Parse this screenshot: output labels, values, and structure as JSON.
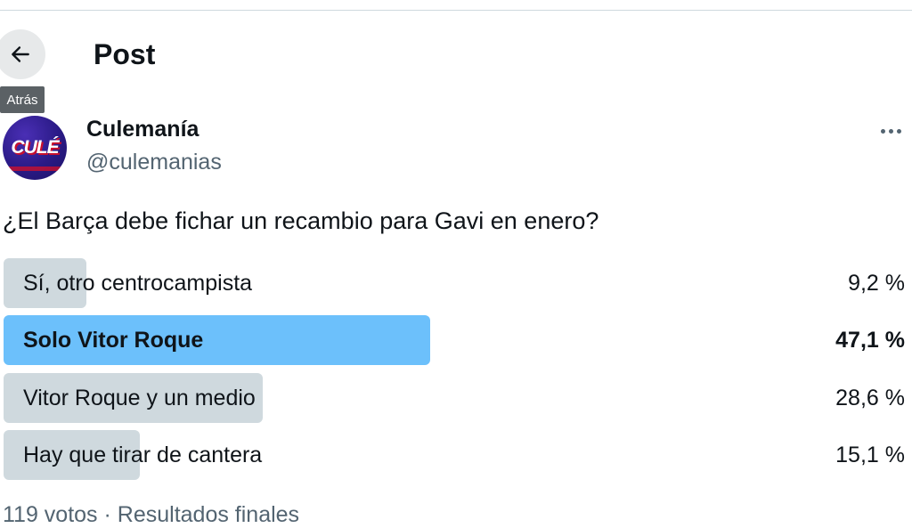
{
  "header": {
    "title": "Post",
    "back_tooltip": "Atrás",
    "back_icon": "arrow-left-icon"
  },
  "author": {
    "name": "Culemanía",
    "handle": "@culemanias",
    "avatar_text": "CULÉ",
    "more_icon": "more-horizontal-icon"
  },
  "post": {
    "question": "¿El Barça debe fichar un recambio para Gavi en enero?"
  },
  "poll": {
    "options": [
      {
        "label": "Sí, otro centrocampista",
        "percent_label": "9,2 %",
        "percent": 9.2,
        "winner": false
      },
      {
        "label": "Solo Vitor Roque",
        "percent_label": "47,1 %",
        "percent": 47.1,
        "winner": true
      },
      {
        "label": "Vitor Roque y un medio",
        "percent_label": "28,6 %",
        "percent": 28.6,
        "winner": false
      },
      {
        "label": "Hay que tirar de cantera",
        "percent_label": "15,1 %",
        "percent": 15.1,
        "winner": false
      }
    ],
    "footer": "119 votos · Resultados finales"
  },
  "colors": {
    "winner_bar": "#6cc0fb",
    "bar": "#cfd9de",
    "secondary_text": "#536471"
  }
}
